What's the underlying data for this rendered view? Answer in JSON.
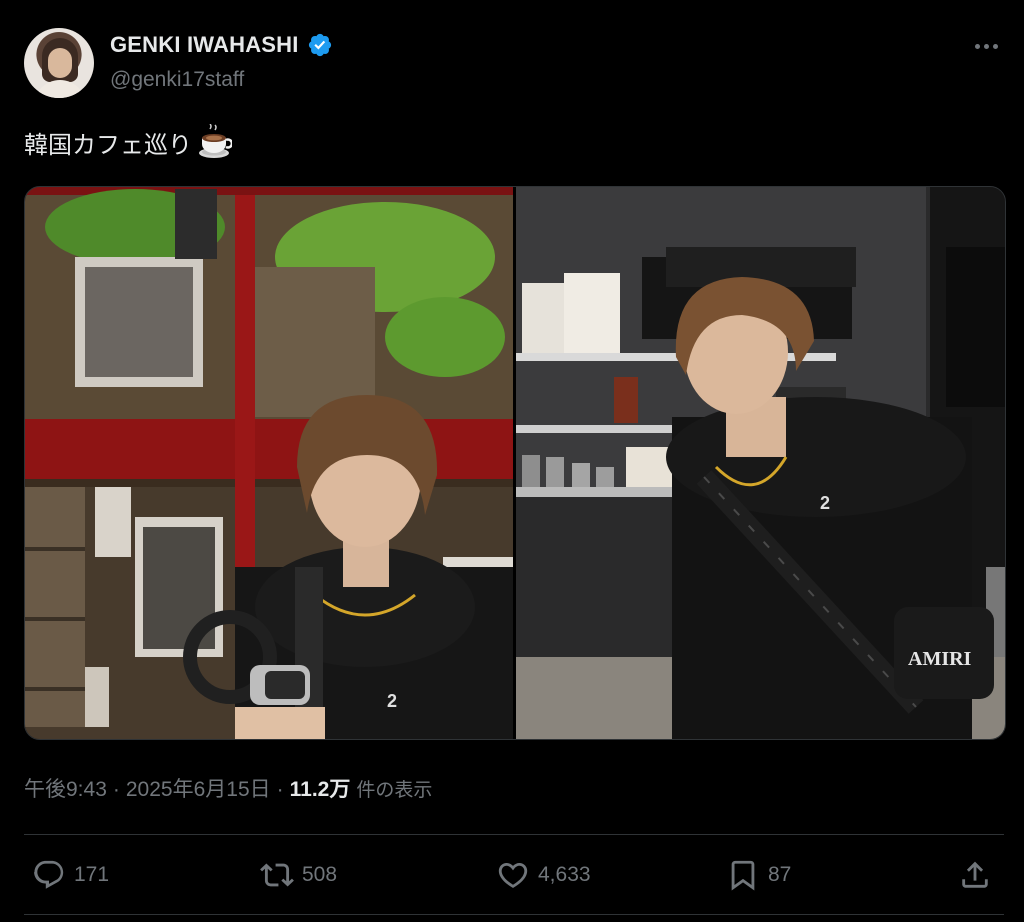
{
  "author": {
    "display_name": "GENKI IWAHASHI",
    "handle": "@genki17staff",
    "verified": true
  },
  "tweet": {
    "text": "韓国カフェ巡り",
    "emoji_icon": "coffee-cup-icon"
  },
  "media": {
    "photo_count": 2
  },
  "meta": {
    "time": "午後9:43",
    "separator": "·",
    "date": "2025年6月15日",
    "separator2": "·",
    "views_count": "11.2万",
    "views_label": "件の表示"
  },
  "actions": {
    "replies": "171",
    "retweets": "508",
    "likes": "4,633",
    "bookmarks": "87"
  },
  "colors": {
    "background": "#000000",
    "text_primary": "#e7e9ea",
    "text_secondary": "#71767b",
    "verified_blue": "#1d9bf0",
    "border": "#2f3336"
  }
}
